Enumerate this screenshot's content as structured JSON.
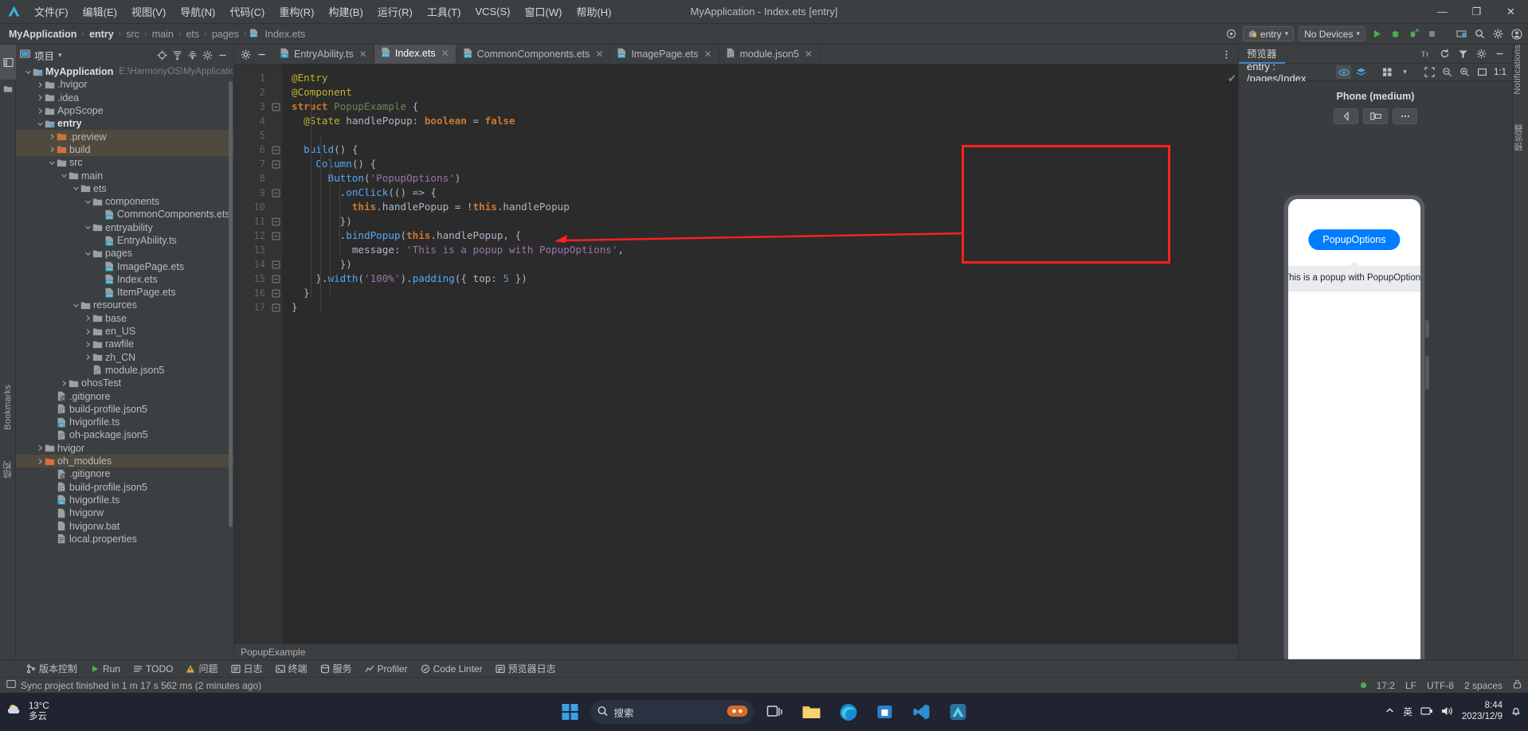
{
  "window": {
    "title": "MyApplication - Index.ets [entry]",
    "minimize": "—",
    "restore": "❐",
    "close": "✕"
  },
  "menubar": {
    "logo_name": "deveco-logo-icon",
    "items": [
      {
        "label": "文件(F)",
        "name": "menu-file"
      },
      {
        "label": "编辑(E)",
        "name": "menu-edit"
      },
      {
        "label": "视图(V)",
        "name": "menu-view"
      },
      {
        "label": "导航(N)",
        "name": "menu-navigate"
      },
      {
        "label": "代码(C)",
        "name": "menu-code"
      },
      {
        "label": "重构(R)",
        "name": "menu-refactor"
      },
      {
        "label": "构建(B)",
        "name": "menu-build"
      },
      {
        "label": "运行(R)",
        "name": "menu-run"
      },
      {
        "label": "工具(T)",
        "name": "menu-tools"
      },
      {
        "label": "VCS(S)",
        "name": "menu-vcs"
      },
      {
        "label": "窗口(W)",
        "name": "menu-window"
      },
      {
        "label": "帮助(H)",
        "name": "menu-help"
      }
    ]
  },
  "navbar": {
    "crumbs": [
      "MyApplication",
      "entry",
      "src",
      "main",
      "ets",
      "pages",
      "Index.ets"
    ],
    "separator": "›",
    "run_config": "entry",
    "device_select": "No Devices",
    "caret": "▾"
  },
  "project_panel": {
    "title": "项目",
    "caret": "▾",
    "tree": [
      {
        "indent": 0,
        "arrow": "v",
        "icon": "module",
        "label": "MyApplication",
        "path": "E:\\HarmonyOS\\MyApplicatio",
        "bold": true
      },
      {
        "indent": 1,
        "arrow": ">",
        "icon": "folder",
        "label": ".hvigor"
      },
      {
        "indent": 1,
        "arrow": ">",
        "icon": "folder",
        "label": ".idea"
      },
      {
        "indent": 1,
        "arrow": ">",
        "icon": "folder",
        "label": "AppScope"
      },
      {
        "indent": 1,
        "arrow": "v",
        "icon": "module",
        "label": "entry",
        "bold": true
      },
      {
        "indent": 2,
        "arrow": ">",
        "icon": "folder-orange",
        "label": ".preview",
        "hl": true
      },
      {
        "indent": 2,
        "arrow": ">",
        "icon": "folder-orange",
        "label": "build",
        "hl": true
      },
      {
        "indent": 2,
        "arrow": "v",
        "icon": "folder",
        "label": "src"
      },
      {
        "indent": 3,
        "arrow": "v",
        "icon": "folder",
        "label": "main"
      },
      {
        "indent": 4,
        "arrow": "v",
        "icon": "folder",
        "label": "ets"
      },
      {
        "indent": 5,
        "arrow": "v",
        "icon": "folder",
        "label": "components"
      },
      {
        "indent": 6,
        "arrow": "",
        "icon": "ets",
        "label": "CommonComponents.ets"
      },
      {
        "indent": 5,
        "arrow": "v",
        "icon": "folder",
        "label": "entryability"
      },
      {
        "indent": 6,
        "arrow": "",
        "icon": "ts",
        "label": "EntryAbility.ts"
      },
      {
        "indent": 5,
        "arrow": "v",
        "icon": "folder",
        "label": "pages"
      },
      {
        "indent": 6,
        "arrow": "",
        "icon": "ets",
        "label": "ImagePage.ets"
      },
      {
        "indent": 6,
        "arrow": "",
        "icon": "ets",
        "label": "Index.ets"
      },
      {
        "indent": 6,
        "arrow": "",
        "icon": "ets",
        "label": "ItemPage.ets"
      },
      {
        "indent": 4,
        "arrow": "v",
        "icon": "folder",
        "label": "resources"
      },
      {
        "indent": 5,
        "arrow": ">",
        "icon": "folder",
        "label": "base"
      },
      {
        "indent": 5,
        "arrow": ">",
        "icon": "folder",
        "label": "en_US"
      },
      {
        "indent": 5,
        "arrow": ">",
        "icon": "folder",
        "label": "rawfile"
      },
      {
        "indent": 5,
        "arrow": ">",
        "icon": "folder",
        "label": "zh_CN"
      },
      {
        "indent": 5,
        "arrow": "",
        "icon": "json5",
        "label": "module.json5"
      },
      {
        "indent": 3,
        "arrow": ">",
        "icon": "folder",
        "label": "ohosTest"
      },
      {
        "indent": 2,
        "arrow": "",
        "icon": "gitignore",
        "label": ".gitignore"
      },
      {
        "indent": 2,
        "arrow": "",
        "icon": "json5",
        "label": "build-profile.json5"
      },
      {
        "indent": 2,
        "arrow": "",
        "icon": "ts",
        "label": "hvigorfile.ts"
      },
      {
        "indent": 2,
        "arrow": "",
        "icon": "json5",
        "label": "oh-package.json5"
      },
      {
        "indent": 1,
        "arrow": ">",
        "icon": "folder",
        "label": "hvigor"
      },
      {
        "indent": 1,
        "arrow": ">",
        "icon": "folder-orange",
        "label": "oh_modules",
        "hl": true
      },
      {
        "indent": 2,
        "arrow": "",
        "icon": "gitignore",
        "label": ".gitignore"
      },
      {
        "indent": 2,
        "arrow": "",
        "icon": "json5",
        "label": "build-profile.json5"
      },
      {
        "indent": 2,
        "arrow": "",
        "icon": "ts",
        "label": "hvigorfile.ts"
      },
      {
        "indent": 2,
        "arrow": "",
        "icon": "file",
        "label": "hvigorw"
      },
      {
        "indent": 2,
        "arrow": "",
        "icon": "file",
        "label": "hvigorw.bat"
      },
      {
        "indent": 2,
        "arrow": "",
        "icon": "props",
        "label": "local.properties"
      }
    ]
  },
  "left_rail": {
    "bookmarks": "Bookmarks",
    "structure": "结构"
  },
  "right_rail": {
    "notifications": "Notifications",
    "previewer": "预览器"
  },
  "editor": {
    "tabs": [
      {
        "label": "EntryAbility.ts",
        "icon": "ts",
        "active": false
      },
      {
        "label": "Index.ets",
        "icon": "ets",
        "active": true
      },
      {
        "label": "CommonComponents.ets",
        "icon": "ets",
        "active": false
      },
      {
        "label": "ImagePage.ets",
        "icon": "ets",
        "active": false
      },
      {
        "label": "module.json5",
        "icon": "json5",
        "active": false
      }
    ],
    "line_numbers": [
      "1",
      "2",
      "3",
      "4",
      "5",
      "6",
      "7",
      "8",
      "9",
      "10",
      "11",
      "12",
      "13",
      "14",
      "15",
      "16",
      "17"
    ],
    "breadcrumb_status": "PopupExample",
    "code_lines": [
      "@Entry",
      "@Component",
      "struct PopupExample {",
      "  @State handlePopup: boolean = false",
      "",
      "  build() {",
      "    Column() {",
      "      Button('PopupOptions')",
      "        .onClick(() => {",
      "          this.handlePopup = !this.handlePopup",
      "        })",
      "        .bindPopup(this.handlePopup, {",
      "          message: 'This is a popup with PopupOptions',",
      "        })",
      "    }.width('100%').padding({ top: 5 })",
      "  }",
      "}"
    ]
  },
  "previewer": {
    "tab_label": "预览器",
    "path": "entry : /pages/Index",
    "device_name": "Phone (medium)",
    "zoom_label": "1:1",
    "popup_button_label": "PopupOptions",
    "popup_message": "This is a popup with PopupOptions",
    "accent_color": "#007dff",
    "highlight_color": "#ff2020"
  },
  "bottom_tools": [
    {
      "label": "版本控制",
      "icon": "branch",
      "name": "tool-version-control"
    },
    {
      "label": "Run",
      "icon": "play",
      "name": "tool-run"
    },
    {
      "label": "TODO",
      "icon": "list",
      "name": "tool-todo"
    },
    {
      "label": "问题",
      "icon": "warn",
      "name": "tool-problems"
    },
    {
      "label": "日志",
      "icon": "log",
      "name": "tool-log"
    },
    {
      "label": "终端",
      "icon": "terminal",
      "name": "tool-terminal"
    },
    {
      "label": "服务",
      "icon": "service",
      "name": "tool-services"
    },
    {
      "label": "Profiler",
      "icon": "profiler",
      "name": "tool-profiler"
    },
    {
      "label": "Code Linter",
      "icon": "linter",
      "name": "tool-code-linter"
    },
    {
      "label": "预览器日志",
      "icon": "preview-log",
      "name": "tool-previewer-log"
    }
  ],
  "statusbar": {
    "message": "Sync project finished in 1 m 17 s 562 ms (2 minutes ago)",
    "caret_pos": "17:2",
    "line_sep": "LF",
    "encoding": "UTF-8",
    "indent": "2 spaces"
  },
  "taskbar": {
    "weather_temp": "13°C",
    "weather_desc": "多云",
    "search_placeholder": "搜索",
    "time": "8:44",
    "date": "2023/12/9",
    "ime": "英",
    "icons": [
      "start-icon",
      "search-icon",
      "widgets-icon",
      "taskview-icon",
      "explorer-icon",
      "edge-icon",
      "store-icon",
      "vscode-icon",
      "deveco-icon"
    ]
  }
}
